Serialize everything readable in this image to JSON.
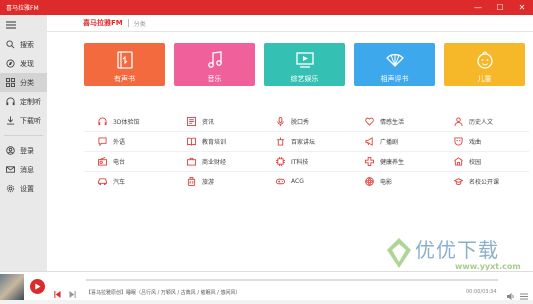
{
  "window": {
    "title": "喜马拉雅FM",
    "controls": [
      "—",
      "☐",
      "✕"
    ]
  },
  "header": {
    "logo": "喜马拉雅FM",
    "breadcrumb": "分类"
  },
  "sidebar": {
    "items": [
      {
        "label": "搜索",
        "icon": "search-icon"
      },
      {
        "label": "发现",
        "icon": "compass-icon"
      },
      {
        "label": "分类",
        "icon": "category-icon",
        "active": true
      },
      {
        "label": "定制听",
        "icon": "headphones-icon"
      },
      {
        "label": "下载听",
        "icon": "download-icon"
      }
    ],
    "bottom_items": [
      {
        "label": "登录",
        "icon": "user-icon"
      },
      {
        "label": "消息",
        "icon": "mail-icon"
      },
      {
        "label": "设置",
        "icon": "gear-icon"
      }
    ]
  },
  "cards": [
    {
      "label": "有声书",
      "color": "#f26a3d",
      "icon": "book-icon"
    },
    {
      "label": "音乐",
      "color": "#f0609a",
      "icon": "music-note-icon"
    },
    {
      "label": "综艺娱乐",
      "color": "#34c1b4",
      "icon": "video-icon"
    },
    {
      "label": "相声评书",
      "color": "#3ea8ec",
      "icon": "fan-icon"
    },
    {
      "label": "儿童",
      "color": "#f6b829",
      "icon": "child-face-icon"
    }
  ],
  "categories": [
    [
      "3D体验馆",
      "资讯",
      "脱口秀",
      "情感生活",
      "历史人文"
    ],
    [
      "外语",
      "教育培训",
      "百家讲坛",
      "广播剧",
      "戏曲"
    ],
    [
      "电台",
      "商业财经",
      "IT科技",
      "健康养生",
      "校园"
    ],
    [
      "汽车",
      "旅游",
      "ACG",
      "电影",
      "名校公开课"
    ]
  ],
  "player": {
    "title": "【喜马拉雅原创】睡眠（吕行风 / 万颖风 / 古典风 / 催眠风 / 悠闲风）",
    "time": "00:00/03:34",
    "progress": 0
  },
  "watermark": {
    "text": "优优下载",
    "url": "www.yyxt.com"
  },
  "accent": "#dd2b2b"
}
